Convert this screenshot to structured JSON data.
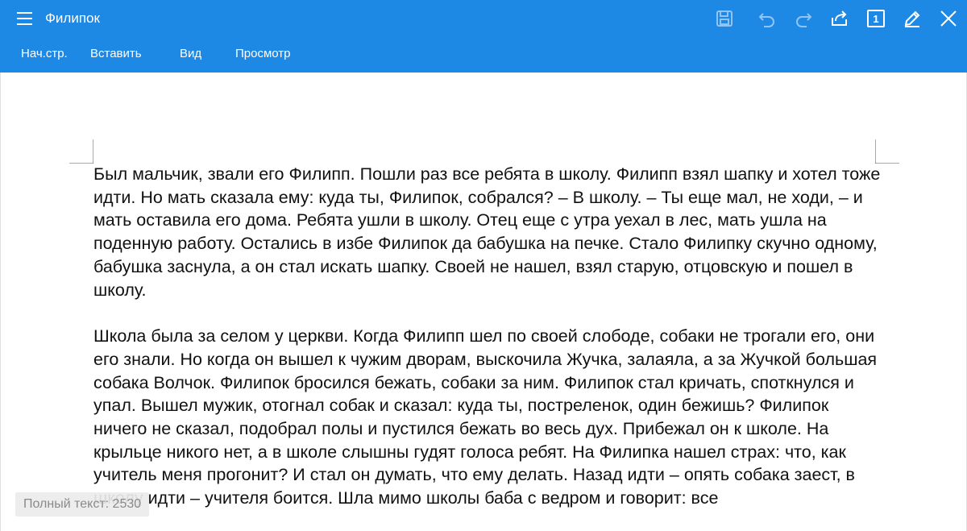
{
  "app": {
    "title": "Филипок"
  },
  "toolbar_icons": [
    "save-icon",
    "undo-icon",
    "redo-icon",
    "share-icon",
    "page-count-icon",
    "edit-icon",
    "close-icon"
  ],
  "toolbar": {
    "page_count": "1"
  },
  "tabs": [
    {
      "label": "Нач.стр."
    },
    {
      "label": "Вставить"
    },
    {
      "label": "Вид"
    },
    {
      "label": "Просмотр"
    }
  ],
  "document": {
    "paragraphs": [
      "Был мальчик, звали его Филипп. Пошли раз все ребята в школу. Филипп взял шапку и хотел тоже идти. Но мать сказала ему: куда ты, Филипок, собрался? – В школу. – Ты еще мал, не ходи, – и мать оставила его дома. Ребята ушли в школу. Отец еще с утра уехал в лес, мать ушла на поденную работу. Остались в избе Филипок да бабушка на печке. Стало Филипку скучно одному, бабушка заснула, а он стал искать шапку. Своей не нашел, взял старую, отцовскую и пошел в школу.",
      "Школа была за селом у церкви. Когда Филипп шел по своей слободе, собаки не трогали его, они его знали. Но когда он вышел к чужим дворам, выскочила Жучка, залаяла, а за Жучкой большая собака Волчок. Филипок бросился бежать, собаки за ним. Филипок стал кричать, споткнулся и упал. Вышел мужик, отогнал собак и сказал: куда ты, постреленок, один бежишь? Филипок ничего не сказал, подобрал полы и пустился бежать во весь дух. Прибежал он к школе. На крыльце никого нет, а в школе слышны гудят голоса ребят. На Филипка нашел страх: что, как учитель меня прогонит? И стал он думать, что ему делать. Назад идти – опять собака заест, в школу идти – учителя боится. Шла мимо школы баба с ведром и говорит: все"
    ]
  },
  "status": {
    "text": "Полный текст: 2530"
  },
  "colors": {
    "appbar": "#1e88e5",
    "disabled_icon": "#90c4f5",
    "text": "#111111"
  }
}
